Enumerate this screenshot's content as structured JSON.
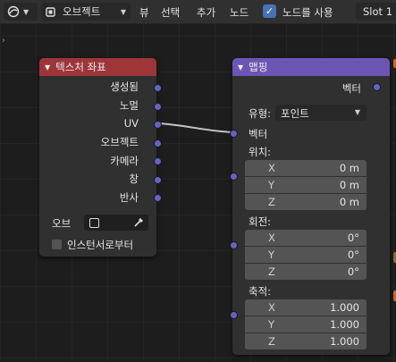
{
  "header": {
    "node_tree_name": "오브젝트",
    "menu": [
      "뷰",
      "선택",
      "추가",
      "노드"
    ],
    "use_nodes_label": "노드를 사용",
    "use_nodes_checked": true,
    "slot_label": "Slot 1"
  },
  "texture_coordinate": {
    "title": "텍스처 좌표",
    "outputs": [
      "생성됨",
      "노멀",
      "UV",
      "오브젝트",
      "카메라",
      "창",
      "반사"
    ],
    "object_label": "오브",
    "from_instancer_label": "인스턴서로부터",
    "from_instancer_checked": false
  },
  "mapping": {
    "title": "맵핑",
    "output": "벡터",
    "type_label": "유형:",
    "type_value": "포인트",
    "vector_input": "벡터",
    "location_label": "위치:",
    "location": [
      {
        "axis": "X",
        "value": "0 m"
      },
      {
        "axis": "Y",
        "value": "0 m"
      },
      {
        "axis": "Z",
        "value": "0 m"
      }
    ],
    "rotation_label": "회전:",
    "rotation": [
      {
        "axis": "X",
        "value": "0°"
      },
      {
        "axis": "Y",
        "value": "0°"
      },
      {
        "axis": "Z",
        "value": "0°"
      }
    ],
    "scale_label": "축적:",
    "scale": [
      {
        "axis": "X",
        "value": "1.000"
      },
      {
        "axis": "Y",
        "value": "1.000"
      },
      {
        "axis": "Z",
        "value": "1.000"
      }
    ]
  },
  "colors": {
    "texture_header": "#9e3539",
    "mapping_header": "#6c55b4",
    "vector_socket": "#6363c7",
    "checkbox_on": "#4772b3"
  }
}
